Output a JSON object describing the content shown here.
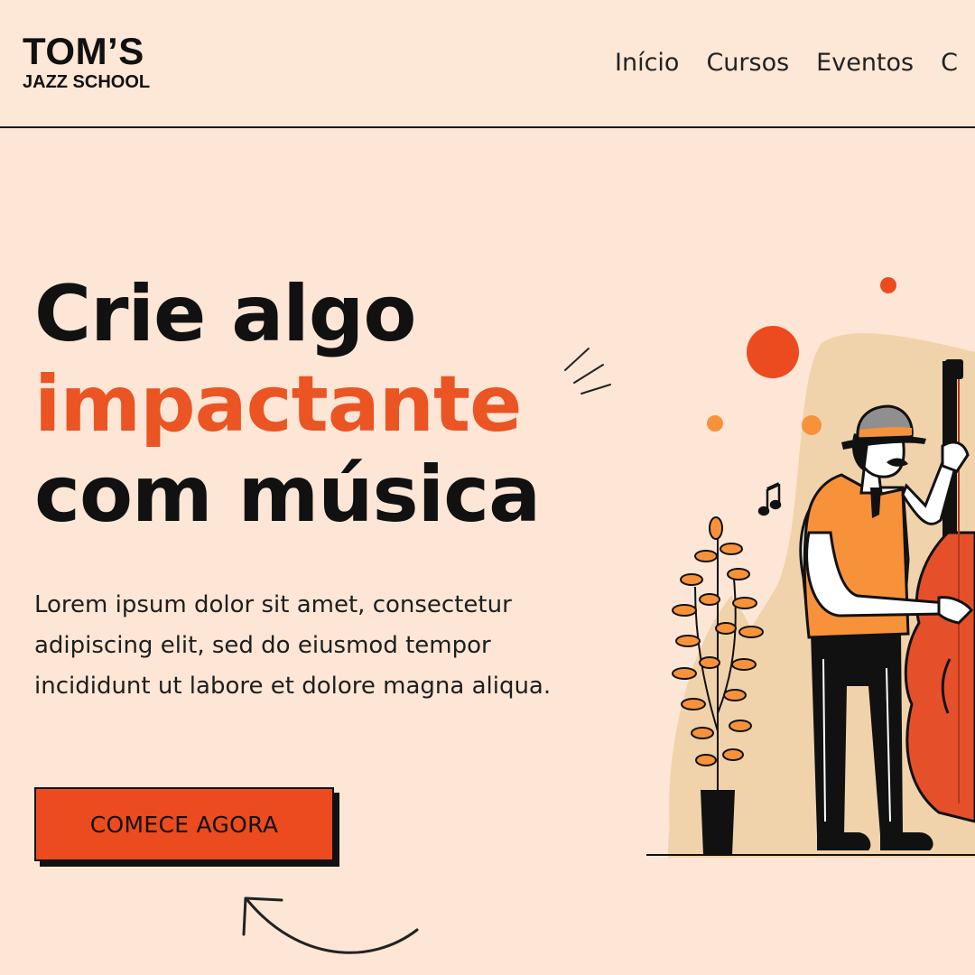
{
  "brand": {
    "name": "TOM’S",
    "subtitle": "JAZZ SCHOOL"
  },
  "nav": {
    "items": [
      {
        "label": "Início"
      },
      {
        "label": "Cursos"
      },
      {
        "label": "Eventos"
      },
      {
        "label": "C"
      }
    ]
  },
  "hero": {
    "headline_line1": "Crie algo",
    "headline_accent": "impactante",
    "headline_line3": "com música",
    "body": "Lorem ipsum dolor sit amet, consectetur adipiscing elit, sed do eiusmod tempor incididunt ut labore et dolore magna aliqua.",
    "cta_label": "COMECE AGORA"
  },
  "colors": {
    "background": "#FDE6D5",
    "accent": "#EB5423",
    "button": "#EB4B1E",
    "blob": "#F0D3AB",
    "vest": "#F7923A"
  },
  "icons": {
    "decor_lines": "sparkle-lines",
    "arrow": "curved-arrow",
    "music_note": "music-note-icon"
  }
}
